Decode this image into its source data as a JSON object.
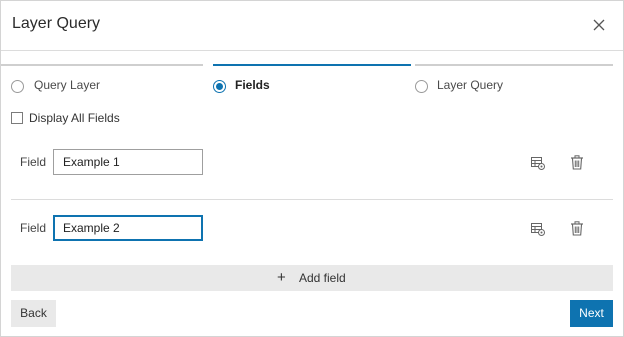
{
  "dialog": {
    "title": "Layer Query",
    "close_icon": "close-icon"
  },
  "steps": [
    {
      "label": "Query Layer",
      "active": false
    },
    {
      "label": "Fields",
      "active": true
    },
    {
      "label": "Layer Query",
      "active": false
    }
  ],
  "display_all": {
    "label": "Display All Fields",
    "checked": false
  },
  "fields": [
    {
      "label": "Field",
      "value": "Example 1",
      "focused": false
    },
    {
      "label": "Field",
      "value": "Example 2",
      "focused": true
    }
  ],
  "icons": {
    "table": "table-settings-icon",
    "delete": "trash-icon"
  },
  "add_field": {
    "label": "Add field",
    "icon": "plus-icon"
  },
  "buttons": {
    "back": "Back",
    "next": "Next"
  },
  "colors": {
    "accent": "#0e73b0",
    "secondary_button": "#e9e9e9"
  }
}
